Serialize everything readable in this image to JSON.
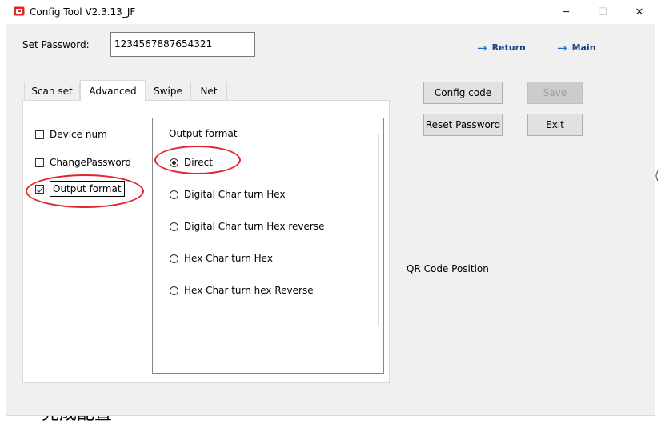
{
  "window": {
    "title": "Config Tool V2.3.13_JF",
    "controls": {
      "minimize": "─",
      "maximize": "☐",
      "close": "✕"
    }
  },
  "password": {
    "label": "Set Password:",
    "value": "1234567887654321"
  },
  "nav": {
    "return_label": "Return",
    "main_label": "Main"
  },
  "tabs": [
    {
      "label": "Scan set",
      "active": false
    },
    {
      "label": "Advanced",
      "active": true
    },
    {
      "label": "Swipe",
      "active": false
    },
    {
      "label": "Net",
      "active": false
    }
  ],
  "options": [
    {
      "label": "Device num",
      "checked": false
    },
    {
      "label": "ChangePassword",
      "checked": false
    },
    {
      "label": "Output format",
      "checked": true
    }
  ],
  "output_format": {
    "title": "Output format",
    "choices": [
      {
        "label": "Direct",
        "selected": true
      },
      {
        "label": "Digital Char turn Hex",
        "selected": false
      },
      {
        "label": "Digital Char turn Hex reverse",
        "selected": false
      },
      {
        "label": "Hex Char turn Hex",
        "selected": false
      },
      {
        "label": "Hex Char turn hex Reverse",
        "selected": false
      }
    ]
  },
  "buttons": {
    "config_code": "Config code",
    "save": "Save",
    "reset_password": "Reset Password",
    "exit": "Exit"
  },
  "qr_position_label": "QR Code Position",
  "annotation_color": "#e0262b",
  "accent_color": "#1f6fd1",
  "background_fragments": {
    "bottom": "完成配置",
    "right_top": "⟨",
    "right_bottom": "!"
  }
}
